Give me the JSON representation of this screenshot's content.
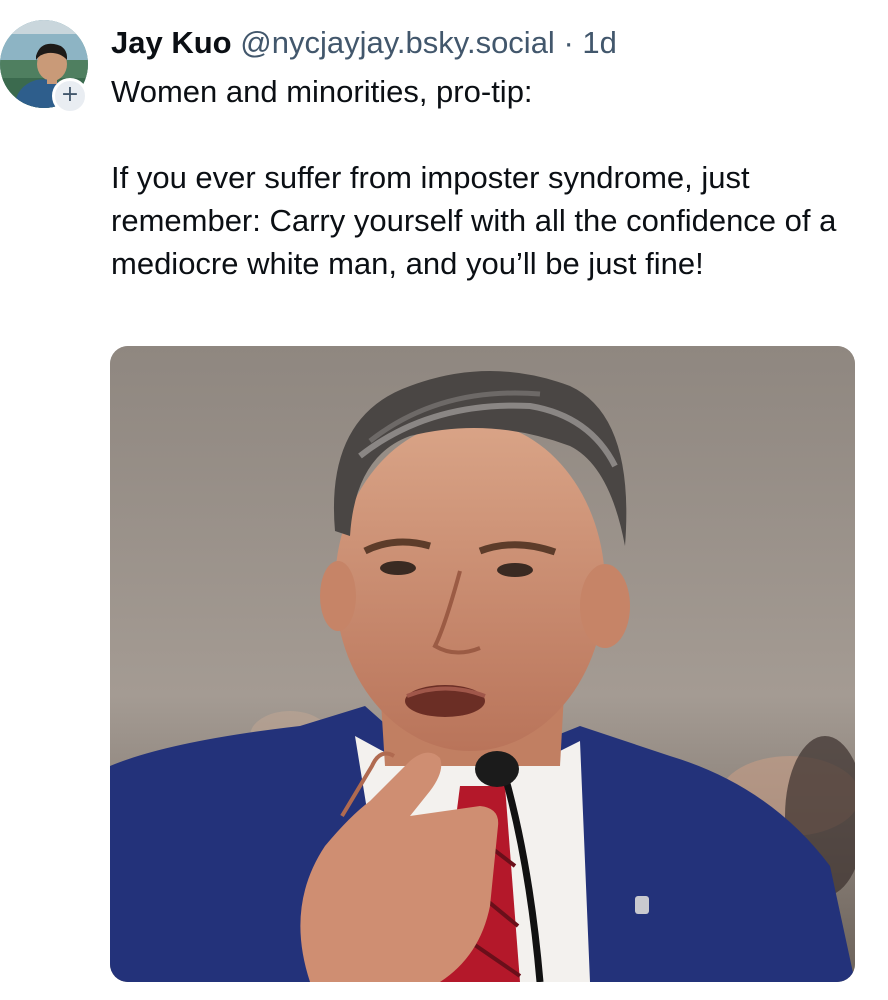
{
  "author": {
    "display_name": "Jay Kuo",
    "handle": "@nycjayjay.bsky.social",
    "separator": "·",
    "time_ago": "1d",
    "follow_icon": "plus-icon"
  },
  "post": {
    "line1": "Women and minorities, pro-tip:",
    "paragraph2": "If you ever suffer from imposter syndrome, just remember: Carry yourself with all the confidence of a mediocre white man, and you’ll be just fine!"
  },
  "colors": {
    "text_primary": "#0b0f14",
    "text_secondary": "#42576c",
    "background": "#ffffff",
    "badge_bg": "#e9edf2"
  }
}
